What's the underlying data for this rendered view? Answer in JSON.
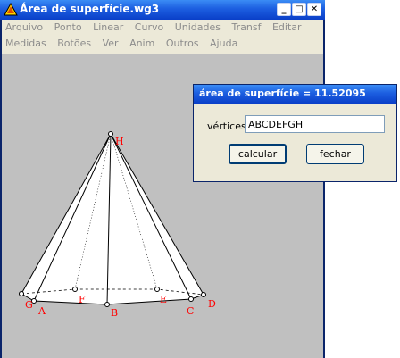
{
  "window": {
    "title": "Área de superfície.wg3",
    "controls": {
      "minimize": "_",
      "maximize": "□",
      "close": "✕"
    }
  },
  "menu": {
    "row1": [
      "Arquivo",
      "Ponto",
      "Linear",
      "Curvo",
      "Unidades",
      "Transf",
      "Editar"
    ],
    "row2": [
      "Medidas",
      "Botões",
      "Ver",
      "Anim",
      "Outros",
      "Ajuda"
    ]
  },
  "figure": {
    "points": [
      "H",
      "G",
      "A",
      "F",
      "B",
      "E",
      "C",
      "D"
    ],
    "label_color": "#ff0000"
  },
  "dialog": {
    "title": "área de superfície = 11.52095",
    "vertices_label": "vértices",
    "vertices_value": "ABCDEFGH",
    "calculate_label": "calcular",
    "close_label": "fechar"
  },
  "colors": {
    "canvas": "#c0c0c0",
    "titlebar": "#1c5ee0",
    "menu_bg": "#ece9d8"
  }
}
